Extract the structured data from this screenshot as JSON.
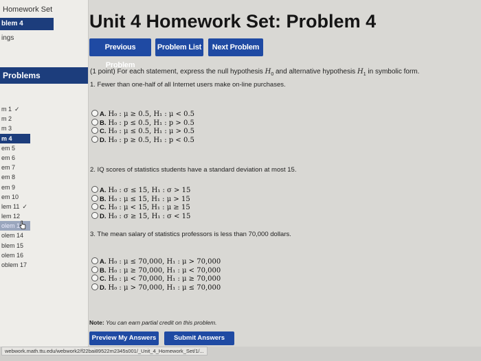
{
  "sidebar": {
    "course_link": "Homework Set",
    "current_problem": "blem 4",
    "settings_link": "ings",
    "problems_header": "Problems",
    "items": [
      {
        "label": "m 1",
        "check": "✓"
      },
      {
        "label": "m 2",
        "check": ""
      },
      {
        "label": "m 3",
        "check": ""
      },
      {
        "label": "m 4",
        "check": "",
        "current": true
      },
      {
        "label": "em 5",
        "check": ""
      },
      {
        "label": "em 6",
        "check": ""
      },
      {
        "label": "em 7",
        "check": ""
      },
      {
        "label": "em 8",
        "check": ""
      },
      {
        "label": "em 9",
        "check": ""
      },
      {
        "label": "em 10",
        "check": ""
      },
      {
        "label": "lem 11",
        "check": "✓"
      },
      {
        "label": "lem 12",
        "check": ""
      },
      {
        "label": "olem 13",
        "check": "",
        "hover": true
      },
      {
        "label": "olem 14",
        "check": ""
      },
      {
        "label": "blem 15",
        "check": ""
      },
      {
        "label": "olem 16",
        "check": ""
      },
      {
        "label": "oblem 17",
        "check": ""
      }
    ]
  },
  "header": {
    "title": "Unit 4 Homework Set: Problem 4"
  },
  "nav": {
    "previous": "Previous Problem",
    "list": "Problem List",
    "next": "Next Problem"
  },
  "problem": {
    "intro_prefix": "(1 point) For each statement, express the null hypothesis ",
    "intro_h0": "H",
    "intro_h0_sub": "0",
    "intro_mid": " and alternative hypothesis ",
    "intro_h1": "H",
    "intro_h1_sub": "1",
    "intro_suffix": " in symbolic form.",
    "questions": [
      {
        "text": "1.  Fewer than one-half of all Internet users make on-line purchases.",
        "options": [
          {
            "letter": "A.",
            "text": "H₀ : μ ≥ 0.5, H₁ : μ < 0.5"
          },
          {
            "letter": "B.",
            "text": "H₀ : p ≤ 0.5, H₁ : p > 0.5"
          },
          {
            "letter": "C.",
            "text": "H₀ : μ ≤ 0.5, H₁ : μ > 0.5"
          },
          {
            "letter": "D.",
            "text": "H₀ : p ≥ 0.5, H₁ : p < 0.5"
          }
        ]
      },
      {
        "text": "2.  IQ scores of statistics students have a standard deviation at most 15.",
        "options": [
          {
            "letter": "A.",
            "text": "H₀ : σ ≤ 15, H₁ : σ > 15"
          },
          {
            "letter": "B.",
            "text": "H₀ : μ ≤ 15, H₁ : μ > 15"
          },
          {
            "letter": "C.",
            "text": "H₀ : μ < 15, H₁ : μ ≥ 15"
          },
          {
            "letter": "D.",
            "text": "H₀ : σ ≥ 15, H₁ : σ < 15"
          }
        ]
      },
      {
        "text": "3.  The mean salary of statistics professors is less than 70,000 dollars.",
        "options": [
          {
            "letter": "A.",
            "text": "H₀ : μ ≤ 70,000, H₁ : μ > 70,000"
          },
          {
            "letter": "B.",
            "text": "H₀ : μ ≥ 70,000, H₁ : μ < 70,000"
          },
          {
            "letter": "C.",
            "text": "H₀ : μ < 70,000, H₁ : μ ≥ 70,000"
          },
          {
            "letter": "D.",
            "text": "H₀ : μ > 70,000, H₁ : μ ≤ 70,000"
          }
        ]
      }
    ],
    "note_label": "Note:",
    "note_text": " You can earn partial credit on this problem."
  },
  "actions": {
    "preview": "Preview My Answers",
    "submit": "Submit Answers"
  },
  "status": {
    "url": "webwork.math.ttu.edu/webwork2/f22bai89522m2345s001/_Unit_4_Homework_Set/1/..."
  },
  "colors": {
    "accent": "#1c3d7c",
    "button": "#1f4aa3"
  },
  "icons": {
    "check": "check-icon",
    "cursor": "hand-cursor-icon",
    "radio": "radio-icon"
  }
}
